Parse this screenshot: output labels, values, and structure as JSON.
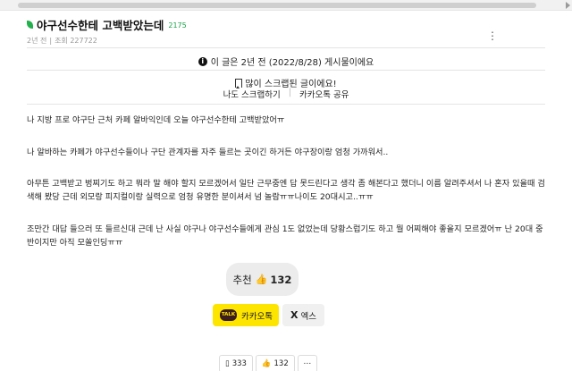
{
  "post": {
    "title": "야구선수한테 고백받았는데",
    "comment_count": "2175",
    "age": "2년 전",
    "views": "조회 227722",
    "more_icon": "⋮"
  },
  "notice": {
    "icon": "i",
    "text": "이 글은 2년 전 (2022/8/28) 게시물이에요"
  },
  "scrap": {
    "text": "많이 스크랩된 글이에요!",
    "my_scrap_label": "나도 스크랩하기",
    "kakao_share_label": "카카오톡 공유"
  },
  "body": {
    "paragraphs": [
      "나 지방 프로 야구단 근처 카페 알바익인데 오늘 야구선수한테 고백받았어ㅠ",
      "나 알바하는 카페가 야구선수들이나 구단 관계자를 자주 들르는 곳이긴 하거든 야구장이랑 엄청 가까워서..",
      "아무튼 고백받고 벙찌기도 하고 뭐라 말 해야 할지 모르겠어서 일단 근무중엔 답 못드린다고 생각 좀 해본다고 했더니 이름 알려주셔서 나 혼자 있을때 검색해 봤당 근데 외모랑 피지컬이랑 실력으로 엄청 유명한 분이셔서 넘 놀람ㅠㅠ나이도 20대시고..ㅠㅠ",
      "조만간 대답 들으러 또 들르신대 근데 난 사실 야구나 야구선수들에게 관심 1도 없었는데 당황스럽기도 하고 뭘 어찌해야 좋을지 모르겠어ㅠ 난 20대 중반이지만 아직 모쏠인딩ㅠㅠ"
    ]
  },
  "recommend": {
    "label": "추천",
    "icon": "👍",
    "count": "132"
  },
  "share": {
    "kakao_badge": "TALK",
    "kakao_label": "카카오톡",
    "x_icon": "X",
    "x_label": "엑스"
  },
  "stats": {
    "scrap_count": "333",
    "like_count": "132",
    "more": "⋯"
  },
  "colors": {
    "kakao_yellow": "#fee500",
    "leaf_green": "#22b14c"
  }
}
